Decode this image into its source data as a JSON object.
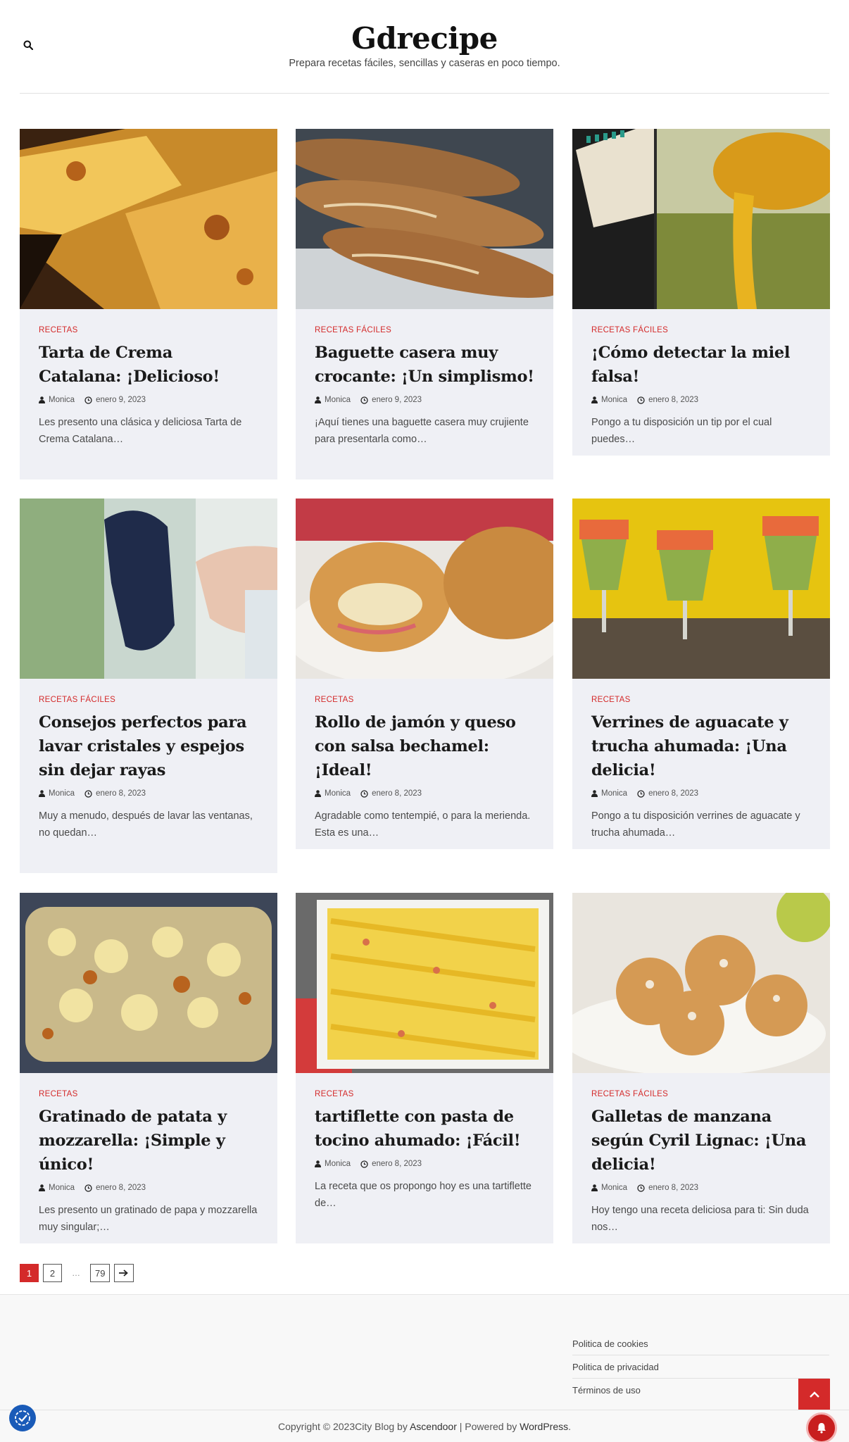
{
  "header": {
    "title": "Gdrecipe",
    "tagline": "Prepara recetas fáciles, sencillas y caseras en poco tiempo.",
    "search_icon": "search-icon"
  },
  "posts": [
    {
      "category": "RECETAS",
      "title": "Tarta de Crema Catalana: ¡Delicioso!",
      "author": "Monica",
      "date": "enero 9, 2023",
      "excerpt": "Les presento una clásica y deliciosa Tarta de Crema Catalana…"
    },
    {
      "category": "RECETAS FÁCILES",
      "title": "Baguette casera muy crocante: ¡Un simplismo!",
      "author": "Monica",
      "date": "enero 9, 2023",
      "excerpt": "¡Aquí tienes una baguette casera muy crujiente para presentarla como…"
    },
    {
      "category": "RECETAS FÁCILES",
      "title": "¡Cómo detectar la miel falsa!",
      "author": "Monica",
      "date": "enero 8, 2023",
      "excerpt": "Pongo a tu disposición un tip por el cual puedes…"
    },
    {
      "category": "RECETAS FÁCILES",
      "title": "Consejos perfectos para lavar cristales y espejos sin dejar rayas",
      "author": "Monica",
      "date": "enero 8, 2023",
      "excerpt": "Muy a menudo, después de lavar las ventanas, no quedan…"
    },
    {
      "category": "RECETAS",
      "title": "Rollo de jamón y queso con salsa bechamel: ¡Ideal!",
      "author": "Monica",
      "date": "enero 8, 2023",
      "excerpt": "Agradable como tentempié, o para la merienda. Esta es una…"
    },
    {
      "category": "RECETAS",
      "title": "Verrines de aguacate y trucha ahumada: ¡Una delicia!",
      "author": "Monica",
      "date": "enero 8, 2023",
      "excerpt": "Pongo a tu disposición verrines de aguacate y trucha ahumada…"
    },
    {
      "category": "RECETAS",
      "title": "Gratinado de patata y mozzarella: ¡Simple y único!",
      "author": "Monica",
      "date": "enero 8, 2023",
      "excerpt": "Les presento un gratinado de papa y mozzarella muy singular;…"
    },
    {
      "category": "RECETAS",
      "title": "tartiflette con pasta de tocino ahumado: ¡Fácil!",
      "author": "Monica",
      "date": "enero 8, 2023",
      "excerpt": "La receta que os propongo hoy es una tartiflette de…"
    },
    {
      "category": "RECETAS FÁCILES",
      "title": "Galletas de manzana según Cyril Lignac: ¡Una delicia!",
      "author": "Monica",
      "date": "enero 8, 2023",
      "excerpt": "Hoy tengo una receta deliciosa para ti: Sin duda nos…"
    }
  ],
  "pagination": {
    "current": "1",
    "page2": "2",
    "dots": "…",
    "last": "79",
    "next_icon": "arrow-right-icon"
  },
  "footer": {
    "links": [
      "Politica de cookies",
      "Politica de privacidad",
      "Términos de uso"
    ],
    "copyright_prefix": "Copyright © 2023City Blog by ",
    "theme_link": "Ascendoor",
    "powered_text": " | Powered by ",
    "wp_link": "WordPress",
    "copyright_suffix": "."
  },
  "colors": {
    "accent": "#d42a2a",
    "card_bg": "#eff0f5",
    "cookie_button": "#1a5bb8"
  }
}
